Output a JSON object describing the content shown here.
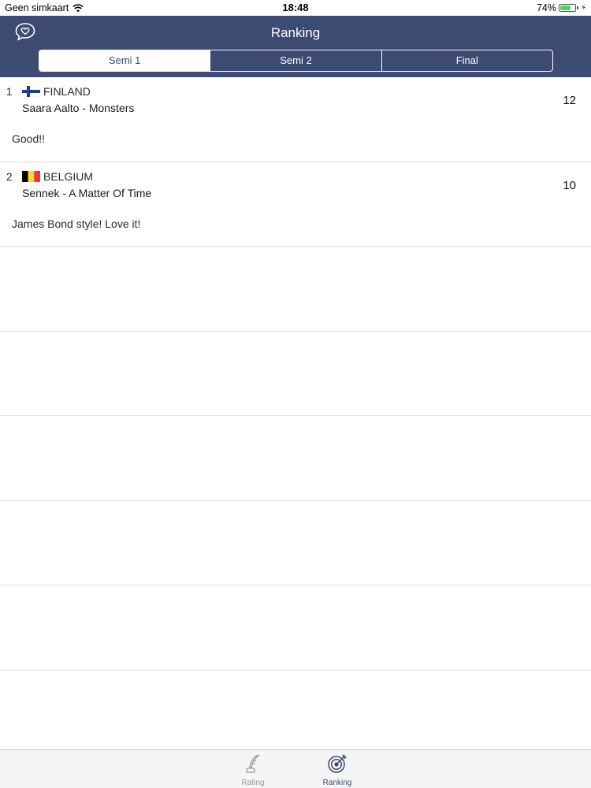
{
  "status_bar": {
    "carrier": "Geen simkaart",
    "time": "18:48",
    "battery_percent": "74%",
    "battery_level": 0.74
  },
  "nav": {
    "title": "Ranking",
    "segments": [
      "Semi 1",
      "Semi 2",
      "Final"
    ],
    "selected_segment": "Semi 1"
  },
  "ranking": [
    {
      "rank": "1",
      "country": "FINLAND",
      "flag": "finland-flag-icon",
      "song": "Saara Aalto - Monsters",
      "comment": "Good!!",
      "points": "12"
    },
    {
      "rank": "2",
      "country": "BELGIUM",
      "flag": "belgium-flag-icon",
      "song": "Sennek - A Matter Of Time",
      "comment": "James Bond style! Love it!",
      "points": "10"
    }
  ],
  "tab_bar": {
    "tabs": [
      {
        "label": "Rating",
        "icon": "quill-pen-icon",
        "selected": false
      },
      {
        "label": "Ranking",
        "icon": "target-dart-icon",
        "selected": true
      }
    ]
  },
  "colors": {
    "nav_background": "#3d4a72",
    "battery": "#4cd964",
    "separator": "#dcdcdc"
  }
}
